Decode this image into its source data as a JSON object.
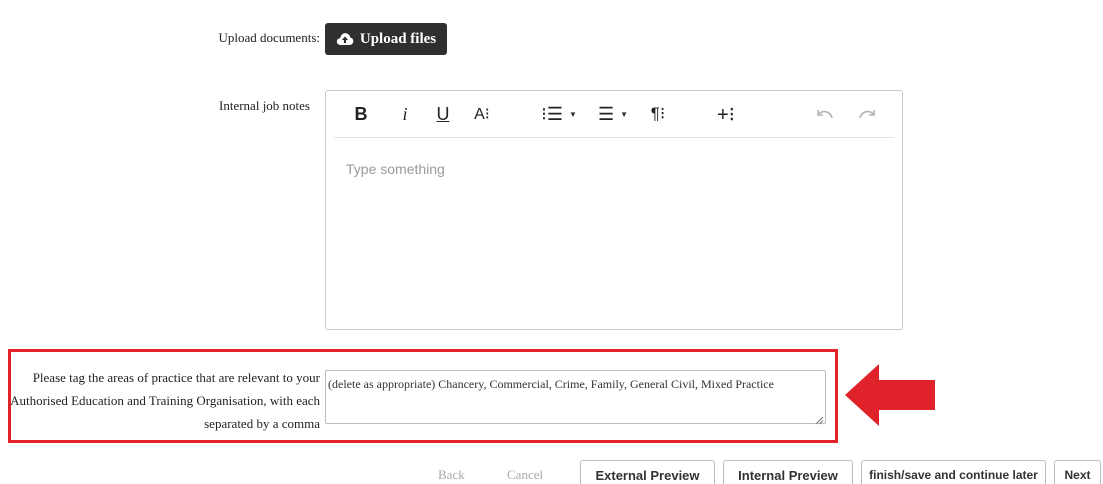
{
  "upload": {
    "label": "Upload documents:",
    "button_label": "Upload files",
    "icon": "cloud-upload-icon"
  },
  "notes": {
    "label": "Internal job notes",
    "placeholder": "Type something",
    "toolbar": {
      "bold": "B",
      "italic": "i",
      "underline": "U",
      "font_size": "A⁝",
      "ordered_list": "⁝☰",
      "unordered_list": "☰",
      "paragraph": "¶⁝",
      "insert": "+⁝",
      "undo_icon": "undo-icon",
      "redo_icon": "redo-icon"
    }
  },
  "tags": {
    "label_line1": "Please tag the areas of practice that are relevant to your",
    "label_line2": "Authorised Education and Training Organisation, with each",
    "label_line3": "separated by a comma",
    "value": "(delete as appropriate) Chancery, Commercial, Crime, Family, General Civil, Mixed Practice",
    "highlight_color": "#e0232a"
  },
  "footer": {
    "back": "Back",
    "cancel": "Cancel",
    "external_preview": "External Preview",
    "internal_preview": "Internal Preview",
    "finish_later": "finish/save and continue later",
    "next": "Next"
  }
}
